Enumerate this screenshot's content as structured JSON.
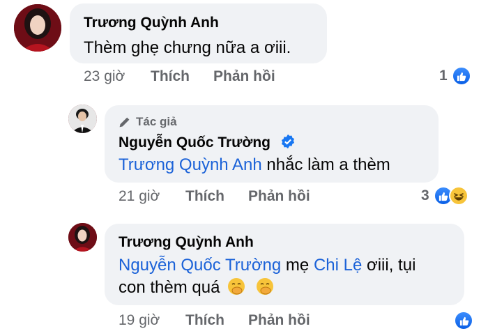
{
  "comments": [
    {
      "author": "Trương Quỳnh Anh",
      "text": "Thèm ghẹ chưng nữa a ơiii.",
      "time": "23 giờ",
      "like_label": "Thích",
      "reply_label": "Phản hồi",
      "reaction_count": "1",
      "reactions": [
        "like-icon"
      ]
    },
    {
      "author_tag": "Tác giả",
      "author": "Nguyễn Quốc Trường",
      "verified": true,
      "mention": "Trương Quỳnh Anh",
      "text": "nhắc làm a thèm",
      "time": "21 giờ",
      "like_label": "Thích",
      "reply_label": "Phản hồi",
      "reaction_count": "3",
      "reactions": [
        "like-icon",
        "haha-icon"
      ]
    },
    {
      "author": "Trương Quỳnh Anh",
      "mention_1": "Nguyễn Quốc Trường",
      "text_1": " mẹ ",
      "mention_2": "Chi Lệ",
      "text_2": " ơiii, tụi",
      "text_3": "con thèm quá",
      "emojis": [
        "hand-over-mouth-emoji",
        "hand-over-mouth-emoji"
      ],
      "time": "19 giờ",
      "like_label": "Thích",
      "reply_label": "Phản hồi",
      "reactions": [
        "like-icon"
      ]
    }
  ],
  "colors": {
    "bubble": "#f0f2f5",
    "mention": "#1b62d8",
    "meta": "#65676b",
    "like": "#0a5fe6",
    "verified": "#1877f2"
  }
}
